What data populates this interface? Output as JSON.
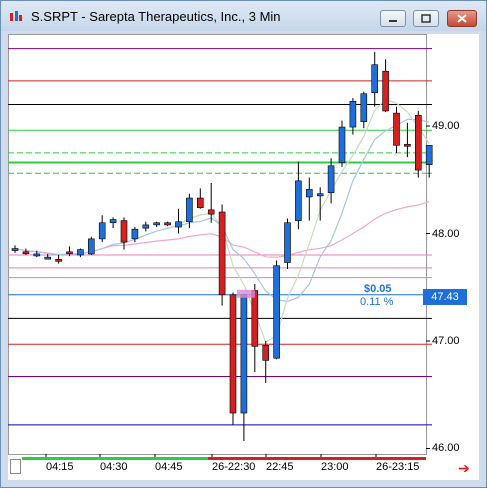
{
  "window": {
    "title": "S.SRPT - Sarepta Therapeutics, Inc., 3 Min"
  },
  "colors": {
    "up": "#1e6fd9",
    "down": "#d32020",
    "price_tag": "#1e6fd9",
    "green_line": "#2ecc40"
  },
  "price_axis": {
    "labels": [
      "49.00",
      "48.00",
      "47.00",
      "46.00"
    ],
    "current_price": "47.43"
  },
  "time_axis": {
    "labels": [
      "04:15",
      "04:30",
      "04:45",
      "26-22:30",
      "22:45",
      "23:00",
      "26-23:15"
    ]
  },
  "annotation": {
    "change": "$0.05",
    "change_pct": "0.11 %"
  },
  "chart_data": {
    "type": "candlestick",
    "ylim": [
      45.9,
      50.0
    ],
    "current_price": 47.43,
    "candles": [
      {
        "o": 47.86,
        "h": 47.89,
        "l": 47.82,
        "c": 47.86
      },
      {
        "o": 47.83,
        "h": 47.86,
        "l": 47.8,
        "c": 47.82
      },
      {
        "o": 47.81,
        "h": 47.84,
        "l": 47.78,
        "c": 47.81
      },
      {
        "o": 47.78,
        "h": 47.81,
        "l": 47.76,
        "c": 47.78
      },
      {
        "o": 47.76,
        "h": 47.8,
        "l": 47.72,
        "c": 47.75
      },
      {
        "o": 47.83,
        "h": 47.88,
        "l": 47.79,
        "c": 47.82
      },
      {
        "o": 47.8,
        "h": 47.86,
        "l": 47.78,
        "c": 47.85
      },
      {
        "o": 47.81,
        "h": 47.97,
        "l": 47.8,
        "c": 47.95
      },
      {
        "o": 47.95,
        "h": 48.17,
        "l": 47.92,
        "c": 48.1
      },
      {
        "o": 48.1,
        "h": 48.15,
        "l": 48.05,
        "c": 48.13
      },
      {
        "o": 48.12,
        "h": 48.15,
        "l": 47.85,
        "c": 47.92
      },
      {
        "o": 47.95,
        "h": 48.06,
        "l": 47.92,
        "c": 48.04
      },
      {
        "o": 48.05,
        "h": 48.11,
        "l": 48.02,
        "c": 48.08
      },
      {
        "o": 48.08,
        "h": 48.11,
        "l": 48.06,
        "c": 48.1
      },
      {
        "o": 48.1,
        "h": 48.11,
        "l": 48.07,
        "c": 48.08
      },
      {
        "o": 48.06,
        "h": 48.23,
        "l": 48.0,
        "c": 48.11
      },
      {
        "o": 48.11,
        "h": 48.37,
        "l": 48.05,
        "c": 48.33
      },
      {
        "o": 48.33,
        "h": 48.42,
        "l": 48.23,
        "c": 48.24
      },
      {
        "o": 48.22,
        "h": 48.47,
        "l": 48.1,
        "c": 48.18
      },
      {
        "o": 48.2,
        "h": 48.27,
        "l": 47.33,
        "c": 47.43
      },
      {
        "o": 47.43,
        "h": 47.45,
        "l": 46.22,
        "c": 46.33
      },
      {
        "o": 46.33,
        "h": 47.44,
        "l": 46.07,
        "c": 47.43
      },
      {
        "o": 47.47,
        "h": 47.53,
        "l": 46.71,
        "c": 46.95
      },
      {
        "o": 46.96,
        "h": 47.0,
        "l": 46.61,
        "c": 46.82
      },
      {
        "o": 46.84,
        "h": 47.75,
        "l": 46.83,
        "c": 47.7
      },
      {
        "o": 47.73,
        "h": 48.14,
        "l": 47.67,
        "c": 48.1
      },
      {
        "o": 48.12,
        "h": 48.67,
        "l": 48.04,
        "c": 48.49
      },
      {
        "o": 48.34,
        "h": 48.52,
        "l": 48.12,
        "c": 48.41
      },
      {
        "o": 48.35,
        "h": 48.43,
        "l": 48.12,
        "c": 48.37
      },
      {
        "o": 48.38,
        "h": 48.7,
        "l": 48.28,
        "c": 48.63
      },
      {
        "o": 48.66,
        "h": 49.05,
        "l": 48.62,
        "c": 48.99
      },
      {
        "o": 48.99,
        "h": 49.26,
        "l": 48.92,
        "c": 49.23
      },
      {
        "o": 49.04,
        "h": 49.32,
        "l": 48.98,
        "c": 49.3
      },
      {
        "o": 49.31,
        "h": 49.69,
        "l": 49.18,
        "c": 49.57
      },
      {
        "o": 49.51,
        "h": 49.62,
        "l": 49.13,
        "c": 49.14
      },
      {
        "o": 49.12,
        "h": 49.18,
        "l": 48.75,
        "c": 48.82
      },
      {
        "o": 48.83,
        "h": 49.03,
        "l": 48.71,
        "c": 48.82
      },
      {
        "o": 49.1,
        "h": 49.14,
        "l": 48.52,
        "c": 48.59
      },
      {
        "o": 48.64,
        "h": 48.79,
        "l": 48.52,
        "c": 48.82
      }
    ],
    "reference_lines": [
      {
        "price": 49.72,
        "color": "#800080"
      },
      {
        "price": 49.42,
        "color": "#d32020"
      },
      {
        "price": 49.2,
        "color": "#000000"
      },
      {
        "price": 48.96,
        "color": "#2ecc40"
      },
      {
        "price": 48.75,
        "color": "#2ecc40"
      },
      {
        "price": 48.66,
        "color": "#2ecc40"
      },
      {
        "price": 48.56,
        "color": "#2ecc40"
      },
      {
        "price": 47.8,
        "color": "#e87fb0"
      },
      {
        "price": 47.68,
        "color": "#e87fb0"
      },
      {
        "price": 47.59,
        "color": "#e87fb0"
      },
      {
        "price": 47.43,
        "color": "#1e6fd9"
      },
      {
        "price": 47.21,
        "color": "#000000"
      },
      {
        "price": 46.97,
        "color": "#d32020"
      },
      {
        "price": 46.67,
        "color": "#800080"
      },
      {
        "price": 46.22,
        "color": "#0000c8"
      }
    ]
  }
}
